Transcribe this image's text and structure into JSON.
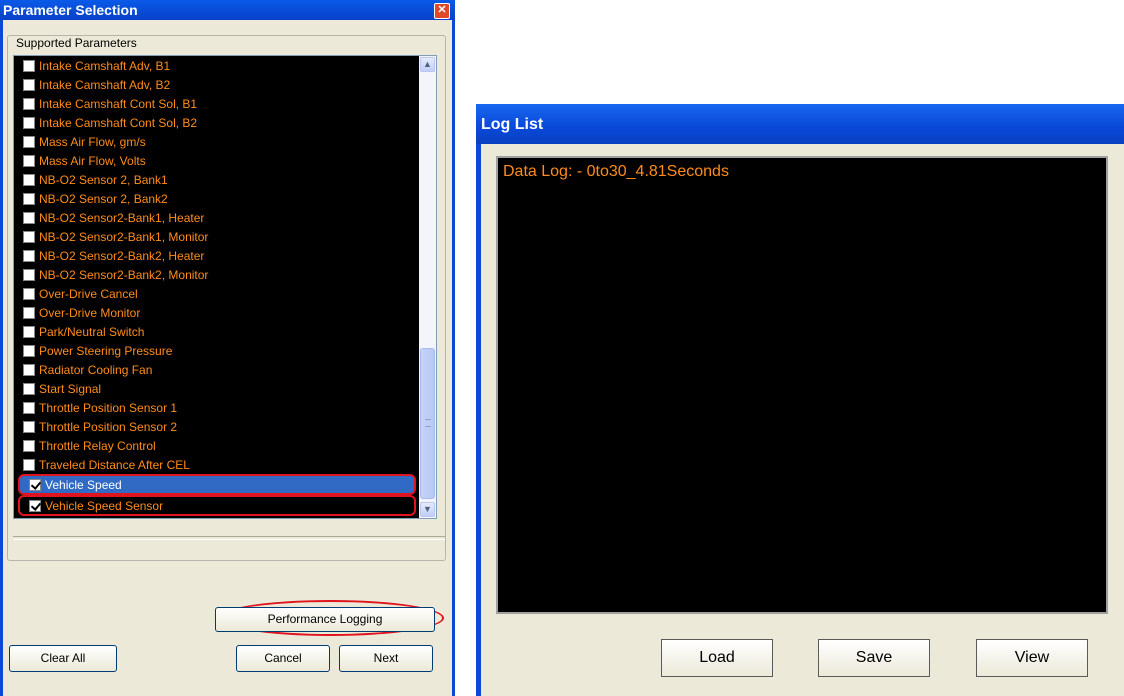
{
  "parameter_window": {
    "title": "Parameter Selection",
    "close_symbol": "✕",
    "group_label": "Supported Parameters",
    "parameters": [
      {
        "label": "Intake Camshaft Adv, B1",
        "checked": false
      },
      {
        "label": "Intake Camshaft Adv, B2",
        "checked": false
      },
      {
        "label": "Intake Camshaft Cont Sol, B1",
        "checked": false
      },
      {
        "label": "Intake Camshaft Cont Sol, B2",
        "checked": false
      },
      {
        "label": "Mass Air Flow, gm/s",
        "checked": false
      },
      {
        "label": "Mass Air Flow, Volts",
        "checked": false
      },
      {
        "label": "NB-O2 Sensor 2, Bank1",
        "checked": false
      },
      {
        "label": "NB-O2 Sensor 2, Bank2",
        "checked": false
      },
      {
        "label": "NB-O2 Sensor2-Bank1, Heater",
        "checked": false
      },
      {
        "label": "NB-O2 Sensor2-Bank1, Monitor",
        "checked": false
      },
      {
        "label": "NB-O2 Sensor2-Bank2, Heater",
        "checked": false
      },
      {
        "label": "NB-O2 Sensor2-Bank2, Monitor",
        "checked": false
      },
      {
        "label": "Over-Drive Cancel",
        "checked": false
      },
      {
        "label": "Over-Drive Monitor",
        "checked": false
      },
      {
        "label": "Park/Neutral Switch",
        "checked": false
      },
      {
        "label": "Power Steering Pressure",
        "checked": false
      },
      {
        "label": "Radiator Cooling Fan",
        "checked": false
      },
      {
        "label": "Start Signal",
        "checked": false
      },
      {
        "label": "Throttle Position Sensor 1",
        "checked": false
      },
      {
        "label": "Throttle Position Sensor 2",
        "checked": false
      },
      {
        "label": "Throttle Relay Control",
        "checked": false
      },
      {
        "label": "Traveled Distance After CEL",
        "checked": false
      },
      {
        "label": "Vehicle Speed",
        "checked": true,
        "selected": true
      },
      {
        "label": "Vehicle Speed Sensor",
        "checked": true
      }
    ],
    "performance_logging_label": "Performance Logging",
    "clear_all_label": "Clear All",
    "cancel_label": "Cancel",
    "next_label": "Next",
    "scroll_up_symbol": "▲",
    "scroll_down_symbol": "▼"
  },
  "log_window": {
    "title": "Log List",
    "entries": [
      "Data Log: - 0to30_4.81Seconds"
    ],
    "load_label": "Load",
    "save_label": "Save",
    "view_label": "View"
  },
  "colors": {
    "list_text": "#ff8c1a",
    "selection": "#316ac5",
    "annotation": "#e0141e",
    "title_bar": "#0a48d8"
  }
}
